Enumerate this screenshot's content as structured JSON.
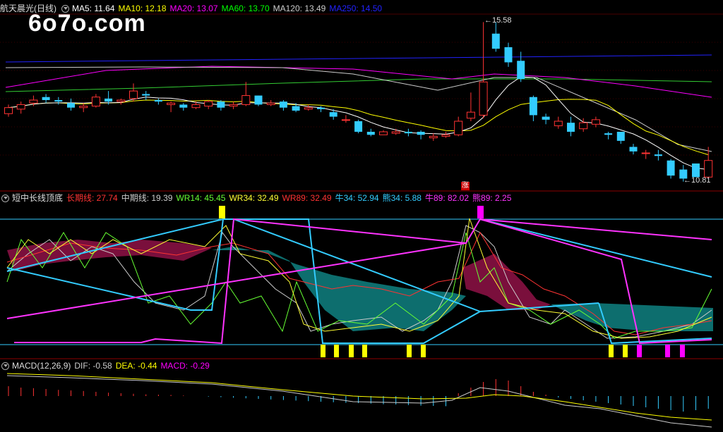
{
  "watermark": "6o7o.com",
  "zhang_badge": "涨",
  "price_panel": {
    "title": "航天晨光(日线)",
    "indicators": [
      {
        "label": "MA5: 11.64",
        "color": "#ffffff"
      },
      {
        "label": "MA10: 12.18",
        "color": "#ffff00"
      },
      {
        "label": "MA20: 13.07",
        "color": "#ff00ff"
      },
      {
        "label": "MA60: 13.70",
        "color": "#00ff00"
      },
      {
        "label": "MA120: 13.49",
        "color": "#cccccc"
      },
      {
        "label": "MA250: 14.50",
        "color": "#2222ff"
      }
    ],
    "high_label": "15.58",
    "low_label": "10.81"
  },
  "indicator_panel": {
    "title": "短中长线顶底",
    "indicators": [
      {
        "label": "长期线: 27.74",
        "color": "#ff3333"
      },
      {
        "label": "中期线: 19.39",
        "color": "#cccccc"
      },
      {
        "label": "WR14: 45.45",
        "color": "#66ff33"
      },
      {
        "label": "WR34: 32.49",
        "color": "#ffff33"
      },
      {
        "label": "WR89: 32.49",
        "color": "#ff3333"
      },
      {
        "label": "牛34: 52.94",
        "color": "#33ccff"
      },
      {
        "label": "熊34: 5.88",
        "color": "#33ccff"
      },
      {
        "label": "牛89: 82.02",
        "color": "#ff33ff"
      },
      {
        "label": "熊89: 2.25",
        "color": "#ff33ff"
      }
    ]
  },
  "macd_panel": {
    "title": "MACD(12,26,9)",
    "indicators": [
      {
        "label": "DIF: -0.58",
        "color": "#cccccc"
      },
      {
        "label": "DEA: -0.44",
        "color": "#ffff00"
      },
      {
        "label": "MACD: -0.29",
        "color": "#ff00ff"
      }
    ]
  },
  "chart_data": {
    "type": "candlestick",
    "series": [
      {
        "name": "K",
        "candles": [
          [
            12.55,
            12.75,
            12.85,
            12.45
          ],
          [
            12.7,
            12.85,
            12.95,
            12.55
          ],
          [
            12.9,
            13.0,
            13.15,
            12.8
          ],
          [
            13.1,
            13.0,
            13.2,
            12.9
          ],
          [
            13.0,
            12.95,
            13.1,
            12.85
          ],
          [
            12.9,
            12.75,
            13.05,
            12.65
          ],
          [
            12.75,
            12.8,
            12.9,
            12.6
          ],
          [
            12.8,
            13.1,
            13.2,
            12.75
          ],
          [
            13.05,
            12.95,
            13.3,
            12.85
          ],
          [
            12.95,
            13.0,
            13.05,
            12.85
          ],
          [
            13.05,
            13.3,
            13.55,
            12.95
          ],
          [
            13.2,
            13.15,
            13.3,
            13.0
          ],
          [
            13.0,
            12.95,
            13.05,
            12.85
          ],
          [
            12.85,
            12.9,
            12.95,
            12.6
          ],
          [
            12.85,
            12.75,
            12.9,
            12.65
          ],
          [
            12.75,
            12.85,
            12.95,
            12.7
          ],
          [
            12.8,
            12.95,
            13.0,
            12.7
          ],
          [
            12.95,
            12.75,
            13.0,
            12.65
          ],
          [
            12.8,
            12.85,
            12.95,
            12.7
          ],
          [
            12.85,
            13.15,
            13.6,
            12.8
          ],
          [
            13.15,
            12.85,
            13.15,
            12.8
          ],
          [
            12.85,
            12.9,
            13.0,
            12.8
          ],
          [
            12.95,
            12.75,
            13.0,
            12.65
          ],
          [
            12.8,
            12.65,
            12.9,
            12.6
          ],
          [
            12.7,
            12.75,
            12.85,
            12.65
          ],
          [
            12.75,
            12.7,
            12.8,
            12.6
          ],
          [
            12.6,
            12.45,
            12.7,
            12.35
          ],
          [
            12.35,
            12.35,
            12.5,
            12.25
          ],
          [
            12.3,
            11.95,
            12.35,
            11.9
          ],
          [
            11.95,
            11.85,
            12.05,
            11.8
          ],
          [
            11.85,
            11.95,
            12.0,
            11.85
          ],
          [
            11.9,
            11.95,
            12.05,
            11.85
          ],
          [
            11.95,
            11.9,
            12.05,
            11.8
          ],
          [
            11.95,
            11.85,
            12.0,
            11.7
          ],
          [
            11.75,
            11.8,
            11.9,
            11.65
          ],
          [
            11.8,
            11.85,
            11.95,
            11.75
          ],
          [
            11.85,
            12.3,
            12.45,
            11.8
          ],
          [
            12.4,
            12.6,
            13.25,
            12.3
          ],
          [
            12.5,
            13.6,
            15.58,
            12.4
          ],
          [
            15.2,
            14.7,
            15.58,
            14.6
          ],
          [
            14.75,
            14.25,
            14.9,
            14.1
          ],
          [
            14.3,
            13.7,
            14.6,
            13.6
          ],
          [
            13.1,
            12.5,
            13.15,
            12.3
          ],
          [
            12.45,
            12.35,
            12.55,
            12.2
          ],
          [
            12.15,
            12.3,
            12.45,
            12.05
          ],
          [
            12.25,
            11.95,
            12.45,
            11.8
          ],
          [
            12.05,
            12.25,
            12.4,
            11.95
          ],
          [
            12.2,
            12.35,
            12.45,
            12.1
          ],
          [
            11.9,
            11.85,
            11.95,
            11.7
          ],
          [
            11.95,
            11.65,
            11.9,
            11.55
          ],
          [
            11.45,
            11.3,
            11.55,
            11.2
          ],
          [
            11.25,
            11.25,
            11.35,
            11.05
          ],
          [
            11.2,
            11.15,
            11.35,
            11.0
          ],
          [
            11.0,
            10.5,
            11.05,
            10.4
          ],
          [
            10.7,
            10.4,
            10.85,
            10.3
          ],
          [
            10.9,
            10.45,
            10.9,
            10.45
          ],
          [
            10.45,
            11.0,
            11.45,
            10.4
          ]
        ]
      }
    ]
  }
}
